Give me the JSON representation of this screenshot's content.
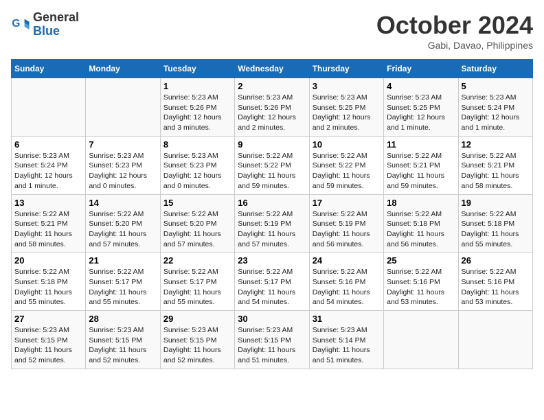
{
  "header": {
    "logo_line1": "General",
    "logo_line2": "Blue",
    "month": "October 2024",
    "location": "Gabi, Davao, Philippines"
  },
  "weekdays": [
    "Sunday",
    "Monday",
    "Tuesday",
    "Wednesday",
    "Thursday",
    "Friday",
    "Saturday"
  ],
  "weeks": [
    [
      {
        "day": "",
        "info": ""
      },
      {
        "day": "",
        "info": ""
      },
      {
        "day": "1",
        "info": "Sunrise: 5:23 AM\nSunset: 5:26 PM\nDaylight: 12 hours and 3 minutes."
      },
      {
        "day": "2",
        "info": "Sunrise: 5:23 AM\nSunset: 5:26 PM\nDaylight: 12 hours and 2 minutes."
      },
      {
        "day": "3",
        "info": "Sunrise: 5:23 AM\nSunset: 5:25 PM\nDaylight: 12 hours and 2 minutes."
      },
      {
        "day": "4",
        "info": "Sunrise: 5:23 AM\nSunset: 5:25 PM\nDaylight: 12 hours and 1 minute."
      },
      {
        "day": "5",
        "info": "Sunrise: 5:23 AM\nSunset: 5:24 PM\nDaylight: 12 hours and 1 minute."
      }
    ],
    [
      {
        "day": "6",
        "info": "Sunrise: 5:23 AM\nSunset: 5:24 PM\nDaylight: 12 hours and 1 minute."
      },
      {
        "day": "7",
        "info": "Sunrise: 5:23 AM\nSunset: 5:23 PM\nDaylight: 12 hours and 0 minutes."
      },
      {
        "day": "8",
        "info": "Sunrise: 5:23 AM\nSunset: 5:23 PM\nDaylight: 12 hours and 0 minutes."
      },
      {
        "day": "9",
        "info": "Sunrise: 5:22 AM\nSunset: 5:22 PM\nDaylight: 11 hours and 59 minutes."
      },
      {
        "day": "10",
        "info": "Sunrise: 5:22 AM\nSunset: 5:22 PM\nDaylight: 11 hours and 59 minutes."
      },
      {
        "day": "11",
        "info": "Sunrise: 5:22 AM\nSunset: 5:21 PM\nDaylight: 11 hours and 59 minutes."
      },
      {
        "day": "12",
        "info": "Sunrise: 5:22 AM\nSunset: 5:21 PM\nDaylight: 11 hours and 58 minutes."
      }
    ],
    [
      {
        "day": "13",
        "info": "Sunrise: 5:22 AM\nSunset: 5:21 PM\nDaylight: 11 hours and 58 minutes."
      },
      {
        "day": "14",
        "info": "Sunrise: 5:22 AM\nSunset: 5:20 PM\nDaylight: 11 hours and 57 minutes."
      },
      {
        "day": "15",
        "info": "Sunrise: 5:22 AM\nSunset: 5:20 PM\nDaylight: 11 hours and 57 minutes."
      },
      {
        "day": "16",
        "info": "Sunrise: 5:22 AM\nSunset: 5:19 PM\nDaylight: 11 hours and 57 minutes."
      },
      {
        "day": "17",
        "info": "Sunrise: 5:22 AM\nSunset: 5:19 PM\nDaylight: 11 hours and 56 minutes."
      },
      {
        "day": "18",
        "info": "Sunrise: 5:22 AM\nSunset: 5:18 PM\nDaylight: 11 hours and 56 minutes."
      },
      {
        "day": "19",
        "info": "Sunrise: 5:22 AM\nSunset: 5:18 PM\nDaylight: 11 hours and 55 minutes."
      }
    ],
    [
      {
        "day": "20",
        "info": "Sunrise: 5:22 AM\nSunset: 5:18 PM\nDaylight: 11 hours and 55 minutes."
      },
      {
        "day": "21",
        "info": "Sunrise: 5:22 AM\nSunset: 5:17 PM\nDaylight: 11 hours and 55 minutes."
      },
      {
        "day": "22",
        "info": "Sunrise: 5:22 AM\nSunset: 5:17 PM\nDaylight: 11 hours and 55 minutes."
      },
      {
        "day": "23",
        "info": "Sunrise: 5:22 AM\nSunset: 5:17 PM\nDaylight: 11 hours and 54 minutes."
      },
      {
        "day": "24",
        "info": "Sunrise: 5:22 AM\nSunset: 5:16 PM\nDaylight: 11 hours and 54 minutes."
      },
      {
        "day": "25",
        "info": "Sunrise: 5:22 AM\nSunset: 5:16 PM\nDaylight: 11 hours and 53 minutes."
      },
      {
        "day": "26",
        "info": "Sunrise: 5:22 AM\nSunset: 5:16 PM\nDaylight: 11 hours and 53 minutes."
      }
    ],
    [
      {
        "day": "27",
        "info": "Sunrise: 5:23 AM\nSunset: 5:15 PM\nDaylight: 11 hours and 52 minutes."
      },
      {
        "day": "28",
        "info": "Sunrise: 5:23 AM\nSunset: 5:15 PM\nDaylight: 11 hours and 52 minutes."
      },
      {
        "day": "29",
        "info": "Sunrise: 5:23 AM\nSunset: 5:15 PM\nDaylight: 11 hours and 52 minutes."
      },
      {
        "day": "30",
        "info": "Sunrise: 5:23 AM\nSunset: 5:15 PM\nDaylight: 11 hours and 51 minutes."
      },
      {
        "day": "31",
        "info": "Sunrise: 5:23 AM\nSunset: 5:14 PM\nDaylight: 11 hours and 51 minutes."
      },
      {
        "day": "",
        "info": ""
      },
      {
        "day": "",
        "info": ""
      }
    ]
  ]
}
